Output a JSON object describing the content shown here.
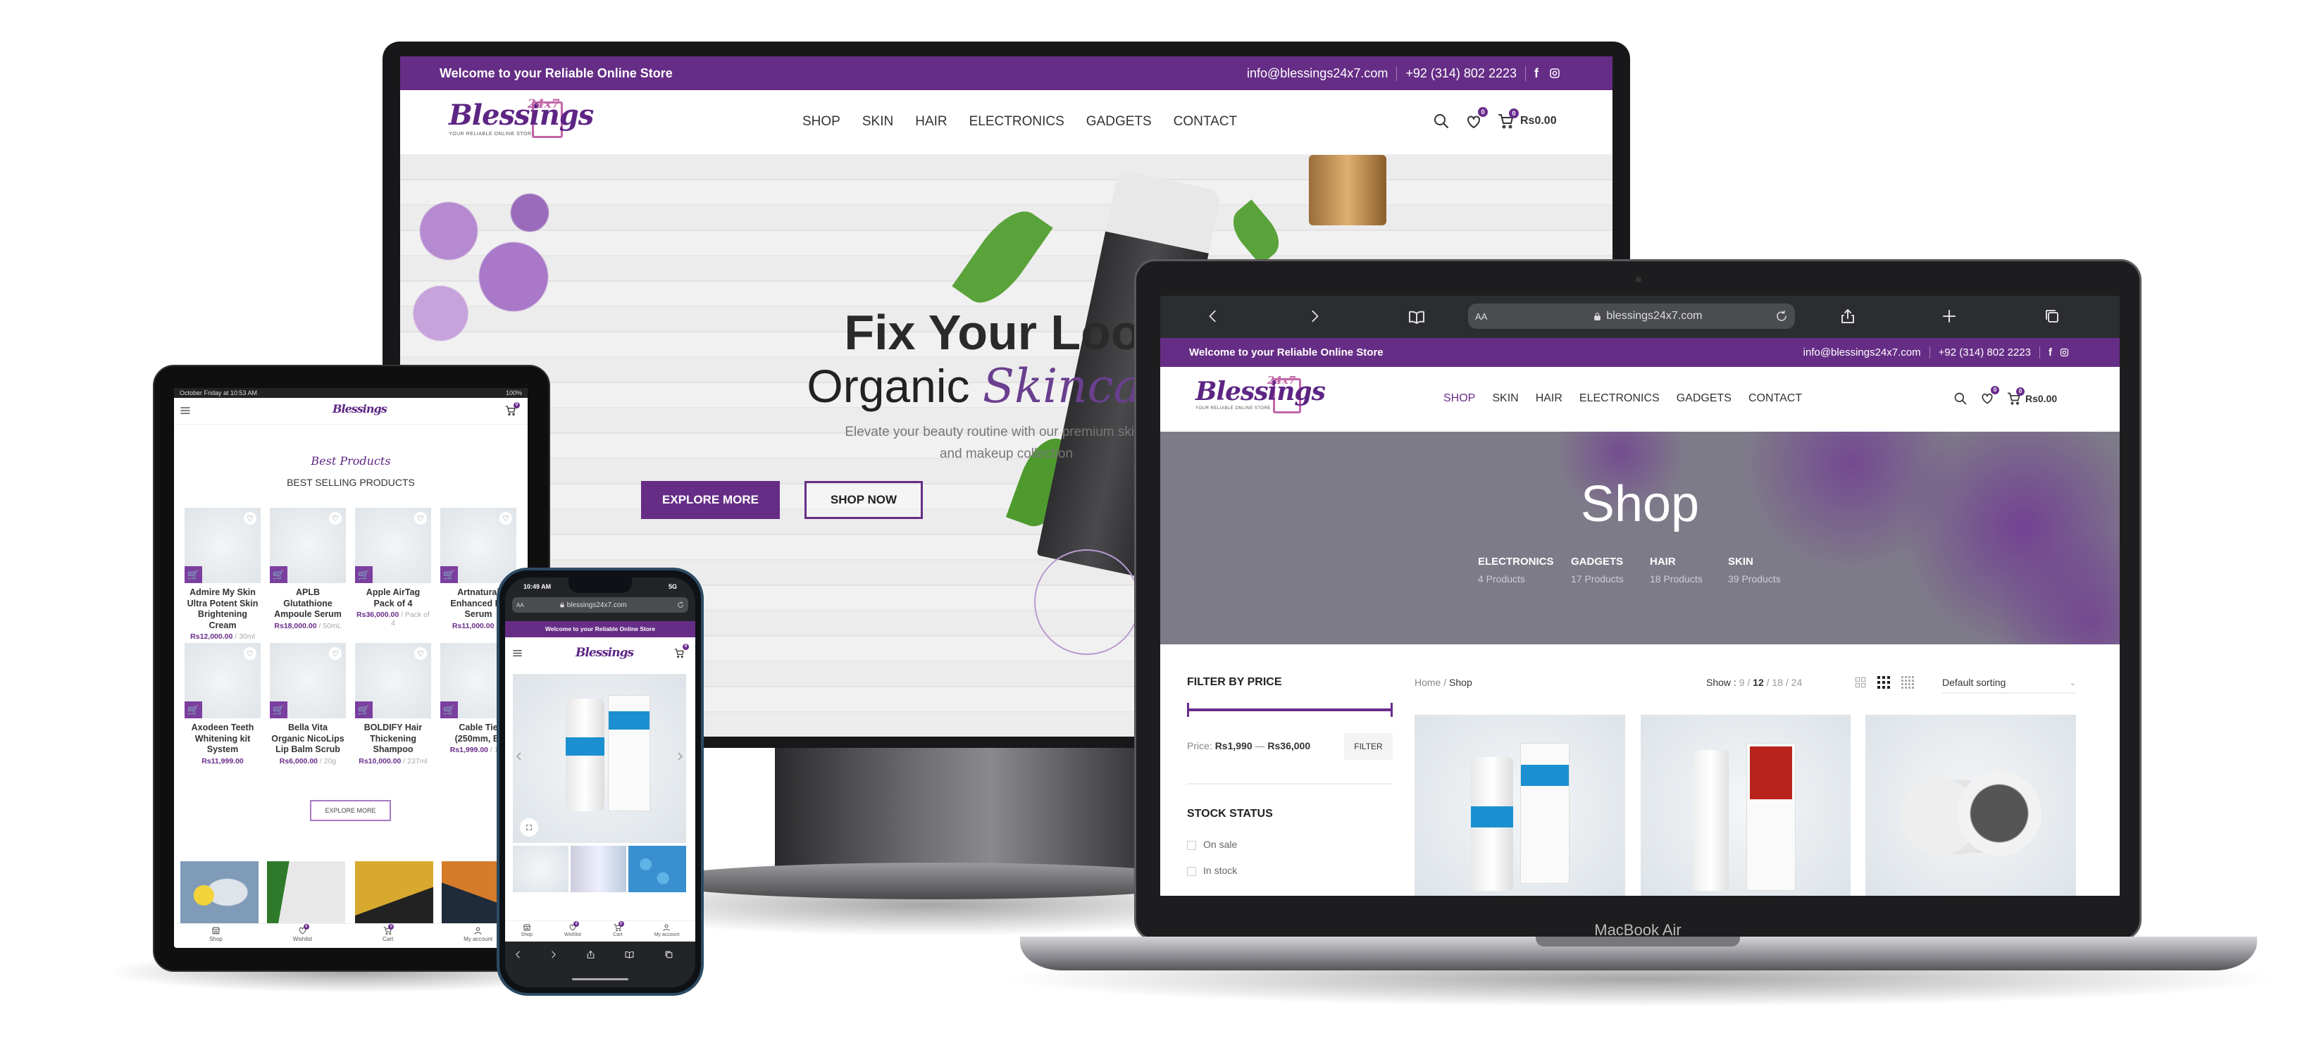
{
  "colors": {
    "brand_purple": "#662d86",
    "accent_purple": "#6a2c8c",
    "shop_hero_gray": "#7e7b89"
  },
  "logo": {
    "name": "Blessings",
    "badge": "24x7",
    "tagline": "YOUR RELIABLE ONLINE STORE"
  },
  "desktop": {
    "topbar": {
      "welcome": "Welcome to your Reliable Online Store",
      "email": "info@blessings24x7.com",
      "phone": "+92 (314) 802 2223"
    },
    "nav": [
      "SHOP",
      "SKIN",
      "HAIR",
      "ELECTRONICS",
      "GADGETS",
      "CONTACT"
    ],
    "wishlist_count": "0",
    "cart_count": "0",
    "cart_total": "Rs0.00",
    "hero": {
      "title": "Fix Your Look",
      "line2_plain": "Organic",
      "line2_script": "Skincare.",
      "subtitle_1": "Elevate your beauty routine with our premium skincare",
      "subtitle_2": "and makeup collection",
      "explore": "EXPLORE MORE",
      "shop": "SHOP NOW"
    }
  },
  "laptop": {
    "label": "MacBook Air",
    "browser": {
      "text_size": "AA",
      "url": "blessings24x7.com"
    },
    "topbar": {
      "welcome": "Welcome to your Reliable Online Store",
      "email": "info@blessings24x7.com",
      "phone": "+92 (314) 802 2223"
    },
    "nav": [
      "SHOP",
      "SKIN",
      "HAIR",
      "ELECTRONICS",
      "GADGETS",
      "CONTACT"
    ],
    "nav_active": "SHOP",
    "wishlist_count": "0",
    "cart_count": "0",
    "cart_total": "Rs0.00",
    "hero": {
      "title": "Shop",
      "categories": [
        {
          "name": "ELECTRONICS",
          "count": "4 Products"
        },
        {
          "name": "GADGETS",
          "count": "17 Products"
        },
        {
          "name": "HAIR",
          "count": "18 Products"
        },
        {
          "name": "SKIN",
          "count": "39 Products"
        }
      ]
    },
    "sidebar": {
      "filter_title": "FILTER BY PRICE",
      "price_label": "Price:",
      "price_min": "Rs1,990",
      "price_sep": "—",
      "price_max": "Rs36,000",
      "filter_button": "FILTER",
      "stock_title": "STOCK STATUS",
      "stock_options": [
        "On sale",
        "In stock"
      ]
    },
    "toolbar": {
      "breadcrumb_home": "Home",
      "breadcrumb_sep": "/",
      "breadcrumb_current": "Shop",
      "show_label": "Show :",
      "show_options": [
        "9",
        "12",
        "18",
        "24"
      ],
      "show_active": "12",
      "sorting": "Default sorting"
    }
  },
  "tablet": {
    "status_time": "October Friday at 10:53 AM",
    "battery": "100%",
    "cart_count": "0",
    "section_script": "Best Products",
    "section_title": "BEST SELLING PRODUCTS",
    "products": [
      {
        "title": "Admire My Skin Ultra Potent Skin Brightening Cream",
        "price": "Rs12,000.00",
        "unit": " / 30ml"
      },
      {
        "title": "APLB Glutathione Ampoule Serum",
        "price": "Rs18,000.00",
        "unit": " / 50mL"
      },
      {
        "title": "Apple AirTag Pack of 4",
        "price": "Rs36,000.00",
        "unit": " / Pack of 4"
      },
      {
        "title": "Artnatural Enhanced Re Serum",
        "price": "Rs11,000.00",
        "unit": " / 3"
      },
      {
        "title": "Axodeen Teeth Whitening kit System",
        "price": "Rs11,999.00",
        "unit": ""
      },
      {
        "title": "Bella Vita Organic NicoLips Lip Balm Scrub",
        "price": "Rs6,000.00",
        "unit": " / 20g"
      },
      {
        "title": "BOLDIFY Hair Thickening Shampoo",
        "price": "Rs10,000.00",
        "unit": " / 237ml"
      },
      {
        "title": "Cable Tie (250mm, Bl",
        "price": "Rs1,999.00",
        "unit": " / 100"
      }
    ],
    "explore": "EXPLORE MORE",
    "bottom_nav": [
      {
        "label": "Shop",
        "icon": "store-icon"
      },
      {
        "label": "Wishlist",
        "icon": "heart-icon",
        "count": "0"
      },
      {
        "label": "Cart",
        "icon": "cart-icon",
        "count": "0"
      },
      {
        "label": "My account",
        "icon": "user-icon"
      }
    ]
  },
  "phone": {
    "time": "10:49 AM",
    "network": "5G",
    "text_size": "AA",
    "url": "blessings24x7.com",
    "welcome": "Welcome to your Reliable Online Store",
    "cart_count": "0",
    "bottom_nav": [
      {
        "label": "Shop",
        "icon": "store-icon"
      },
      {
        "label": "Wishlist",
        "icon": "heart-icon",
        "count": "0"
      },
      {
        "label": "Cart",
        "icon": "cart-icon",
        "count": "0"
      },
      {
        "label": "My account",
        "icon": "user-icon"
      }
    ]
  }
}
